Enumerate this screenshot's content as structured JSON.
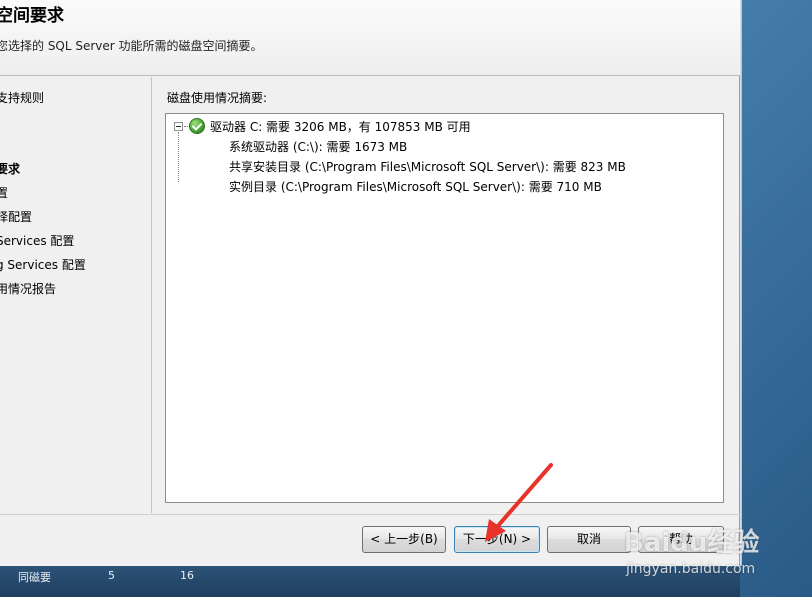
{
  "header": {
    "title": "空间要求",
    "description": "您选择的 SQL Server 功能所需的磁盘空间摘要。"
  },
  "nav": {
    "items": [
      {
        "label": "支持规则",
        "active": false
      },
      {
        "label": "要求",
        "active": true
      },
      {
        "label": "置",
        "active": false
      },
      {
        "label": "择配置",
        "active": false
      },
      {
        "label": "Services 配置",
        "active": false
      },
      {
        "label": "g Services 配置",
        "active": false
      },
      {
        "label": "用情况报告",
        "active": false
      }
    ]
  },
  "content": {
    "label": "磁盘使用情况摘要:",
    "tree": {
      "root": "驱动器 C: 需要 3206 MB，有 107853 MB 可用",
      "children": [
        "系统驱动器 (C:\\): 需要 1673 MB",
        "共享安装目录 (C:\\Program Files\\Microsoft SQL Server\\): 需要 823 MB",
        "实例目录 (C:\\Program Files\\Microsoft SQL Server\\): 需要 710 MB"
      ]
    }
  },
  "buttons": {
    "back": "< 上一步(B)",
    "next": "下一步(N) >",
    "cancel": "取消",
    "help": "帮助"
  },
  "taskbar": {
    "items": [
      "同磁要",
      "5",
      "16"
    ]
  },
  "watermark": {
    "logo": "Baidu经验",
    "url": "jingyan.baidu.com"
  },
  "colors": {
    "arrow": "#e8322a",
    "dialog_bg": "#f0f0f0",
    "next_button_border": "#3c7fb1"
  }
}
